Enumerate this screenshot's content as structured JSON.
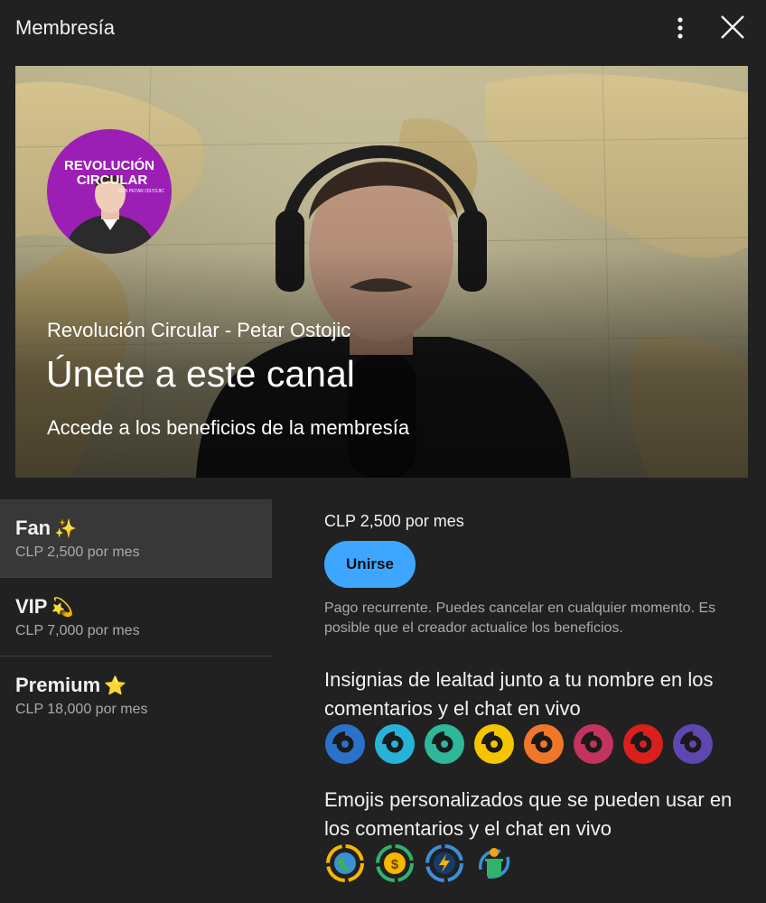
{
  "header": {
    "title": "Membresía",
    "more_icon": "more-vertical-icon",
    "close_icon": "close-icon"
  },
  "banner": {
    "channel_name": "Revolución Circular - Petar Ostojic",
    "title": "Únete a este canal",
    "subtitle": "Accede a los beneficios de la membresía",
    "logo_line1": "REVOLUCIÓN",
    "logo_line2": "CIRCULAR",
    "logo_line3": "CON PETAR OSTOJIC",
    "logo_color": "#9b1fb5"
  },
  "tiers": [
    {
      "name": "Fan",
      "emoji": "✨",
      "price": "CLP 2,500 por mes",
      "selected": true
    },
    {
      "name": "VIP",
      "emoji": "💫",
      "price": "CLP 7,000 por mes",
      "selected": false
    },
    {
      "name": "Premium",
      "emoji": "⭐",
      "price": "CLP 18,000 por mes",
      "selected": false
    }
  ],
  "detail": {
    "price": "CLP 2,500 por mes",
    "join_label": "Unirse",
    "note": "Pago recurrente. Puedes cancelar en cualquier momento. Es posible que el creador actualice los beneficios.",
    "perk_badges": "Insignias de lealtad junto a tu nombre en los comentarios y el chat en vivo",
    "perk_emojis": "Emojis personalizados que se pueden usar en los comentarios y el chat en vivo",
    "badge_colors": [
      "#2a72c9",
      "#27b3d8",
      "#2fb79a",
      "#f5c400",
      "#f0762a",
      "#c2335f",
      "#d9201c",
      "#5f46b0"
    ],
    "emoji_icons": [
      "earth-recycle-icon",
      "money-recycle-icon",
      "energy-recycle-icon",
      "trash-gear-icon"
    ]
  },
  "colors": {
    "accent": "#3ea6ff",
    "background": "#212121",
    "selected_tier": "#383838"
  }
}
